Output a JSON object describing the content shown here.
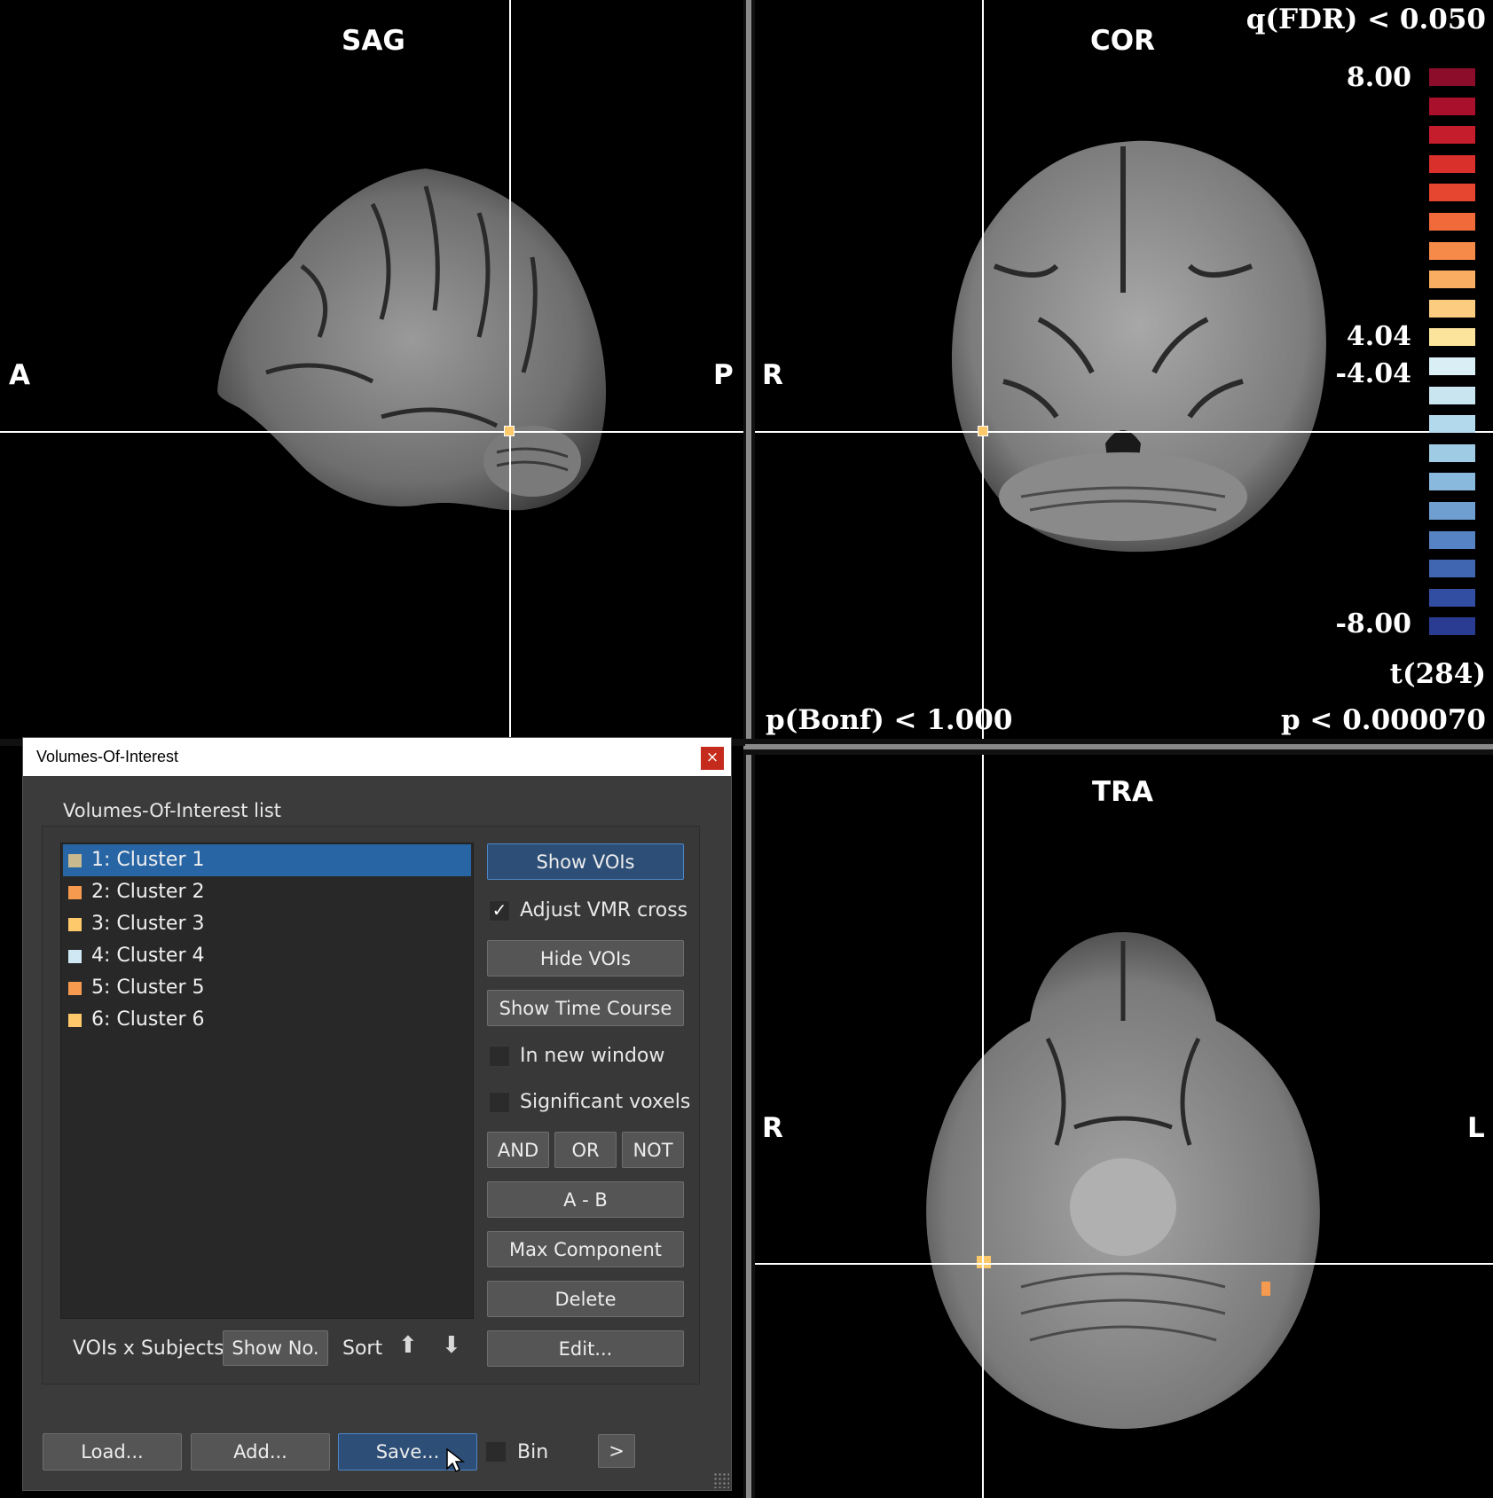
{
  "views": {
    "sag": {
      "title": "SAG",
      "left_label": "A",
      "right_label": "P"
    },
    "cor": {
      "title": "COR",
      "left_label": "R"
    },
    "tra": {
      "title": "TRA",
      "left_label": "R",
      "right_label": "L"
    }
  },
  "stats": {
    "q_fdr": "q(FDR) < 0.050",
    "p_bonf": "p(Bonf) < 1.000",
    "p_value": "p < 0.000070",
    "t_label": "t(284)",
    "colorbar_labels": {
      "max": "8.00",
      "pos_thresh": "4.04",
      "neg_thresh": "-4.04",
      "min": "-8.00"
    },
    "colorbar_colors": [
      "#8b0d2a",
      "#a8102b",
      "#c51d2c",
      "#d9302b",
      "#e6452f",
      "#f06a3a",
      "#f58a49",
      "#f9ad62",
      "#fccc80",
      "#fde49c",
      "#d9eef5",
      "#c8e5f0",
      "#b3d9ec",
      "#9fcbe5",
      "#89b9dd",
      "#6f9fd1",
      "#5683c3",
      "#4066b2",
      "#324ea3",
      "#293c92"
    ]
  },
  "dialog": {
    "title": "Volumes-Of-Interest",
    "close": "×",
    "group_label": "Volumes-Of-Interest list",
    "items": [
      {
        "label": "1: Cluster 1",
        "color": "#c8b98f"
      },
      {
        "label": "2: Cluster 2",
        "color": "#f59a4f"
      },
      {
        "label": "3: Cluster 3",
        "color": "#fdc96a"
      },
      {
        "label": "4: Cluster 4",
        "color": "#cfe8f3"
      },
      {
        "label": "5: Cluster 5",
        "color": "#f59a4f"
      },
      {
        "label": "6: Cluster 6",
        "color": "#fdc96a"
      }
    ],
    "buttons": {
      "show_vois": "Show VOIs",
      "adjust_vmr": "Adjust VMR cross",
      "hide_vois": "Hide VOIs",
      "show_time_course": "Show Time Course",
      "in_new_window": "In new window",
      "significant_voxels": "Significant voxels",
      "and": "AND",
      "or": "OR",
      "not": "NOT",
      "a_minus_b": "A - B",
      "max_component": "Max Component",
      "delete": "Delete",
      "edit": "Edit...",
      "vois_x_subjects": "VOIs x Subjects",
      "show_no": "Show No.",
      "sort": "Sort",
      "load": "Load...",
      "add": "Add...",
      "save": "Save...",
      "bin": "Bin",
      "more": ">"
    }
  }
}
